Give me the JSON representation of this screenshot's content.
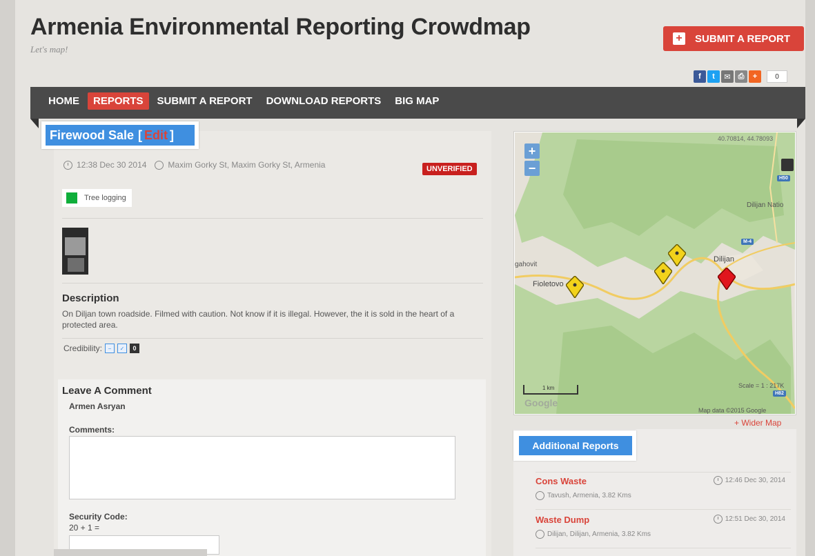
{
  "site": {
    "title": "Armenia Environmental Reporting Crowdmap",
    "tagline": "Let's map!"
  },
  "header": {
    "submit_label": "SUBMIT A REPORT",
    "share_count": "0"
  },
  "nav": {
    "items": [
      {
        "label": "HOME"
      },
      {
        "label": "REPORTS"
      },
      {
        "label": "SUBMIT A REPORT"
      },
      {
        "label": "DOWNLOAD REPORTS"
      },
      {
        "label": "BIG MAP"
      }
    ],
    "active": "REPORTS"
  },
  "report": {
    "title": "Firewood Sale",
    "edit_open": "[",
    "edit_label": "Edit",
    "edit_close": "]",
    "time": "12:38 Dec 30 2014",
    "location": "Maxim Gorky St, Maxim Gorky St, Armenia",
    "status": "UNVERIFIED",
    "category": "Tree logging",
    "category_color": "#0fae3a",
    "description_heading": "Description",
    "description": "On Diljan town roadside. Filmed with caution. Not know if it is illegal. However, the it is sold in the heart of a protected area.",
    "credibility_label": "Credibility:",
    "credibility_score": "0"
  },
  "comment": {
    "heading": "Leave A Comment",
    "user_name": "Armen Asryan",
    "comments_label": "Comments:",
    "comments_value": "",
    "security_label": "Security Code:",
    "security_question": "20 + 1 =",
    "security_value": ""
  },
  "map": {
    "coords": "40.70814, 44.78093",
    "zoom_in": "+",
    "zoom_out": "−",
    "labels": {
      "dilijan": "Dilijan",
      "fioletovo": "Fioletovo",
      "dilijan_national": "Dilijan Natio",
      "gahovit": "gahovit",
      "m4": "M-4",
      "h82": "H82",
      "h50": "H50",
      "scale": "1 km",
      "scale_ratio": "Scale = 1 : 217K",
      "google": "Google",
      "credits": "Map data ©2015 Google"
    },
    "wider_map_label": "+ Wider Map"
  },
  "additional": {
    "heading": "Additional Reports",
    "items": [
      {
        "title": "Cons Waste",
        "time": "12:46 Dec 30, 2014",
        "location": "Tavush, Armenia, 3.82 Kms"
      },
      {
        "title": "Waste Dump",
        "time": "12:51 Dec 30, 2014",
        "location": "Dilijan, Dilijan, Armenia, 3.82 Kms"
      }
    ]
  },
  "colors": {
    "accent_red": "#d9443a",
    "accent_blue": "#3f8fe0",
    "nav_bg": "#4a4a4a"
  }
}
